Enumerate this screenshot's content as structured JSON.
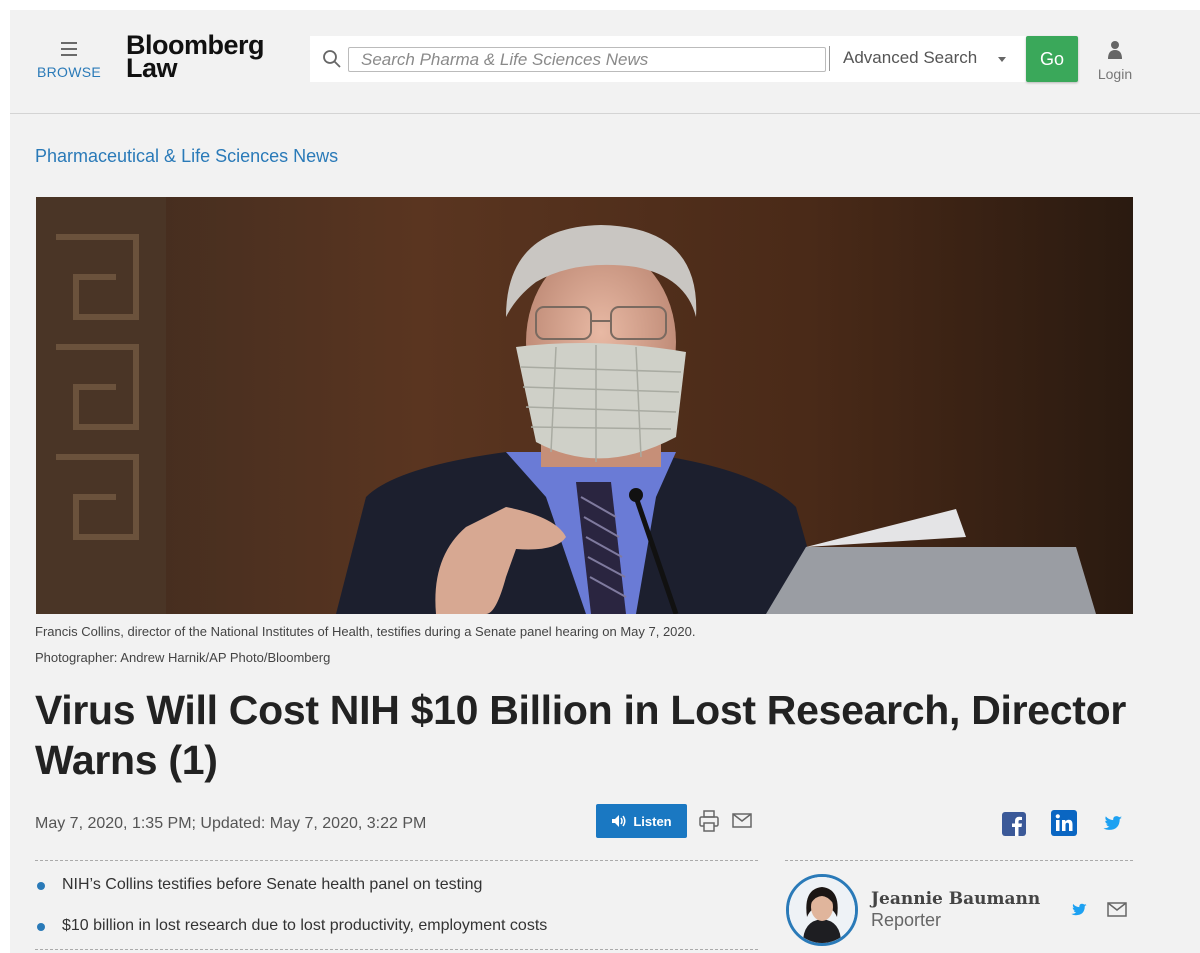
{
  "header": {
    "browse_label": "BROWSE",
    "logo_line1": "Bloomberg",
    "logo_line2": "Law",
    "search_placeholder": "Search Pharma & Life Sciences News",
    "advanced_search": "Advanced Search",
    "go_label": "Go",
    "login_label": "Login"
  },
  "section_title": "Pharmaceutical & Life Sciences News",
  "hero": {
    "caption": "Francis Collins, director of the National Institutes of Health, testifies during a Senate panel hearing on May 7, 2020.",
    "credit": "Photographer: Andrew Harnik/AP Photo/Bloomberg"
  },
  "headline": "Virus Will Cost NIH $10 Billion in Lost Research, Director Warns (1)",
  "meta": {
    "date": "May 7, 2020, 1:35 PM; Updated: May 7, 2020, 3:22 PM",
    "listen_label": "Listen"
  },
  "bullets": [
    "NIH’s Collins testifies before Senate health panel on testing",
    "$10 billion in lost research due to lost productivity, employment costs"
  ],
  "author": {
    "name": "Jeannie Baumann",
    "role": "Reporter"
  },
  "colors": {
    "accent_blue": "#2a7ab8",
    "go_green": "#3aa85a",
    "listen_blue": "#1a78c2",
    "facebook": "#3b5998",
    "linkedin": "#0a66c2",
    "twitter": "#1da1f2"
  },
  "icons": [
    "menu-icon",
    "search-icon",
    "chevron-down-icon",
    "user-icon",
    "speaker-icon",
    "print-icon",
    "mail-icon",
    "facebook-icon",
    "linkedin-icon",
    "twitter-icon"
  ]
}
